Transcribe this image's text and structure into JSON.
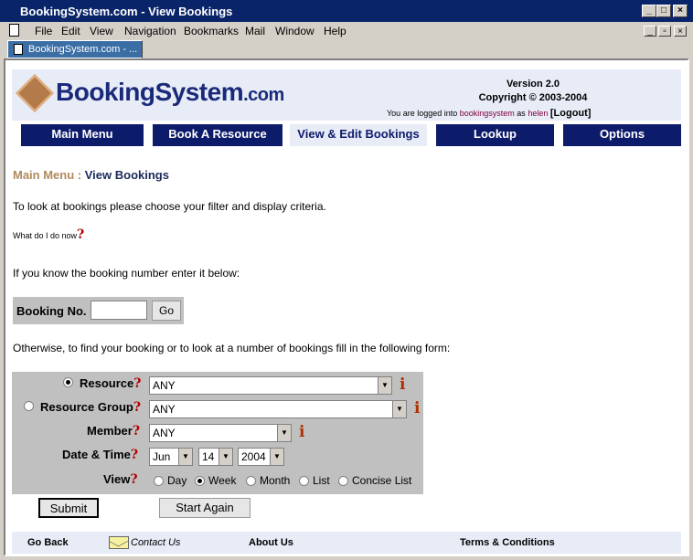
{
  "window": {
    "title": "BookingSystem.com - View Bookings"
  },
  "menu": [
    "File",
    "Edit",
    "View",
    "Navigation",
    "Bookmarks",
    "Mail",
    "Window",
    "Help"
  ],
  "tab": {
    "label": "BookingSystem.com - ..."
  },
  "header": {
    "logo_main": "BookingSystem",
    "logo_suffix": ".com",
    "version": "Version 2.0",
    "copyright": "Copyright © 2003-2004",
    "login_prefix": "You are logged into",
    "login_site": "bookingsystem",
    "login_as": "as",
    "login_user": "helen",
    "logout": "[Logout]"
  },
  "nav": [
    "Main Menu",
    "Book A Resource",
    "View & Edit Bookings",
    "Lookup",
    "Options"
  ],
  "breadcrumb": {
    "parent": "Main Menu :",
    "current": "View Bookings"
  },
  "content": {
    "intro": "To look at bookings please choose your filter and display criteria.",
    "help": "What do I do now",
    "know_number": "If you know the booking number enter it below:",
    "otherwise": "Otherwise, to find your booking or to look at a number of bookings fill in the following form:"
  },
  "booking_no": {
    "label": "Booking No.",
    "value": "",
    "go": "Go"
  },
  "form": {
    "resource_label": "Resource",
    "resource_value": "ANY",
    "resource_group_label": "Resource Group",
    "resource_group_value": "ANY",
    "member_label": "Member",
    "member_value": "ANY",
    "datetime_label": "Date & Time",
    "month": "Jun",
    "day": "14",
    "year": "2004",
    "view_label": "View",
    "view_options": [
      "Day",
      "Week",
      "Month",
      "List",
      "Concise List"
    ],
    "selected_view": "Week",
    "selected_filter": "Resource"
  },
  "buttons": {
    "submit": "Submit",
    "start_again": "Start Again"
  },
  "footer": {
    "go_back": "Go Back",
    "contact": "Contact Us",
    "about": "About Us",
    "terms": "Terms & Conditions"
  },
  "colors": {
    "nav_bg": "#0d1b6b",
    "header_bg": "#e8ecf7",
    "form_bg": "#c0c0c0",
    "breadcrumb_parent": "#b08a5a"
  },
  "icons": [
    "document-icon",
    "question-mark-icon",
    "info-icon",
    "envelope-icon",
    "dropdown-arrow-icon"
  ]
}
